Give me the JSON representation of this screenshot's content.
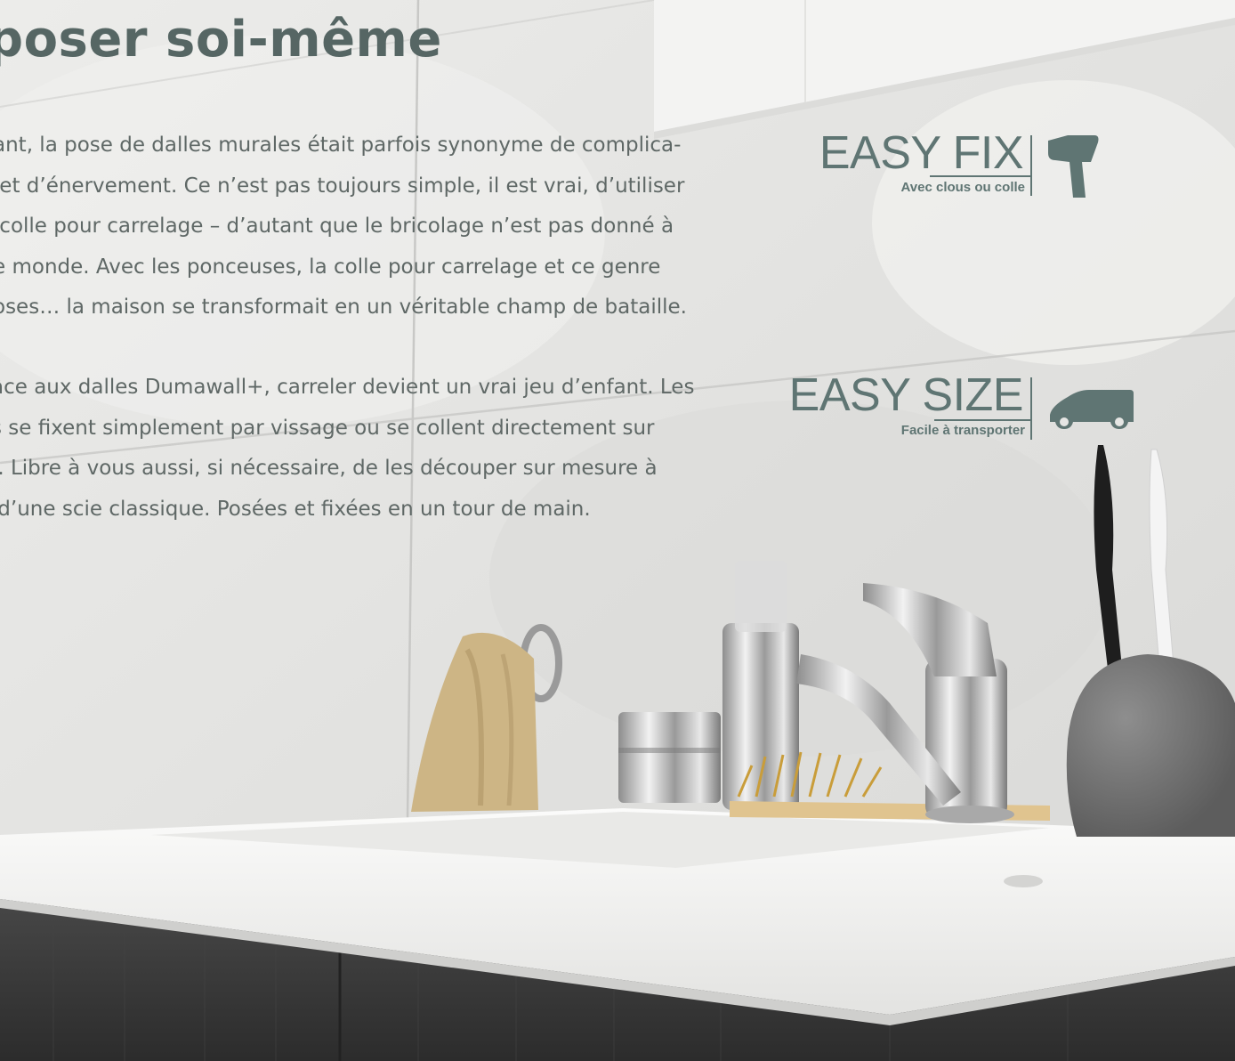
{
  "page": {
    "title": "poser soi-même",
    "paragraphs": [
      "ant, la pose de dalles murales était parfois synonyme de complica-\n et d’énervement. Ce n’est pas toujours simple, il est vrai, d’utiliser\n colle pour carrelage – d’autant que le bricolage n’est pas donné à\ne monde. Avec les ponceuses, la colle pour carrelage et ce genre\noses… la maison se transformait en un véritable champ de bataille.",
      "âce aux dalles Dumawall+, carreler devient un vrai jeu d’enfant. Les\ns se fixent simplement par vissage ou se collent directement sur\nr. Libre à vous aussi, si nécessaire, de les découper sur mesure à\n d’une scie classique. Posées et fixées en un tour de main."
    ]
  },
  "badges": [
    {
      "label": "EASY FIX",
      "subtitle": "Avec clous ou colle",
      "icon": "hammer-icon"
    },
    {
      "label": "EASY SIZE",
      "subtitle": "Facile à transporter",
      "icon": "van-icon"
    }
  ],
  "colors": {
    "title": "#566664",
    "body_text": "#5f6866",
    "badge": "#5f7573",
    "wall": "#e6e6e4",
    "counter": "#f4f4f2",
    "cabinet": "#3a3a3a"
  }
}
